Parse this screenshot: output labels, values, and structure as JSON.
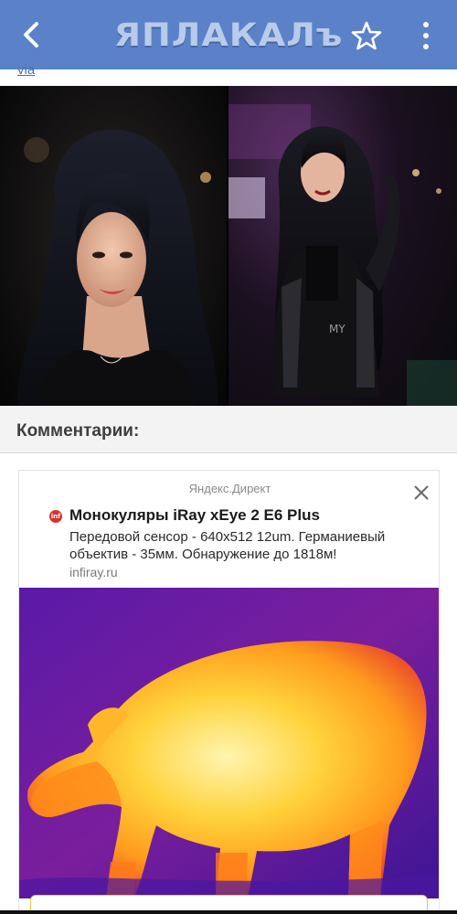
{
  "header": {
    "logo_text": "ЯПЛАКАЛъ",
    "back_icon": "back-arrow-icon",
    "star_icon": "star-outline-icon",
    "more_icon": "more-vertical-icon",
    "background_color": "#5b82c9"
  },
  "post": {
    "via_label": "via"
  },
  "comments": {
    "title": "Комментарии:"
  },
  "ad": {
    "source": "Яндекс.Директ",
    "favicon_text": "inf",
    "title": "Монокуляры iRay xEye 2 E6 Plus",
    "description": "Передовой сенсор - 640x512 12um. Германиевый объектив - 35мм. Обнаружение до 1818м!",
    "domain": "infiray.ru",
    "close_icon": "close-icon"
  }
}
